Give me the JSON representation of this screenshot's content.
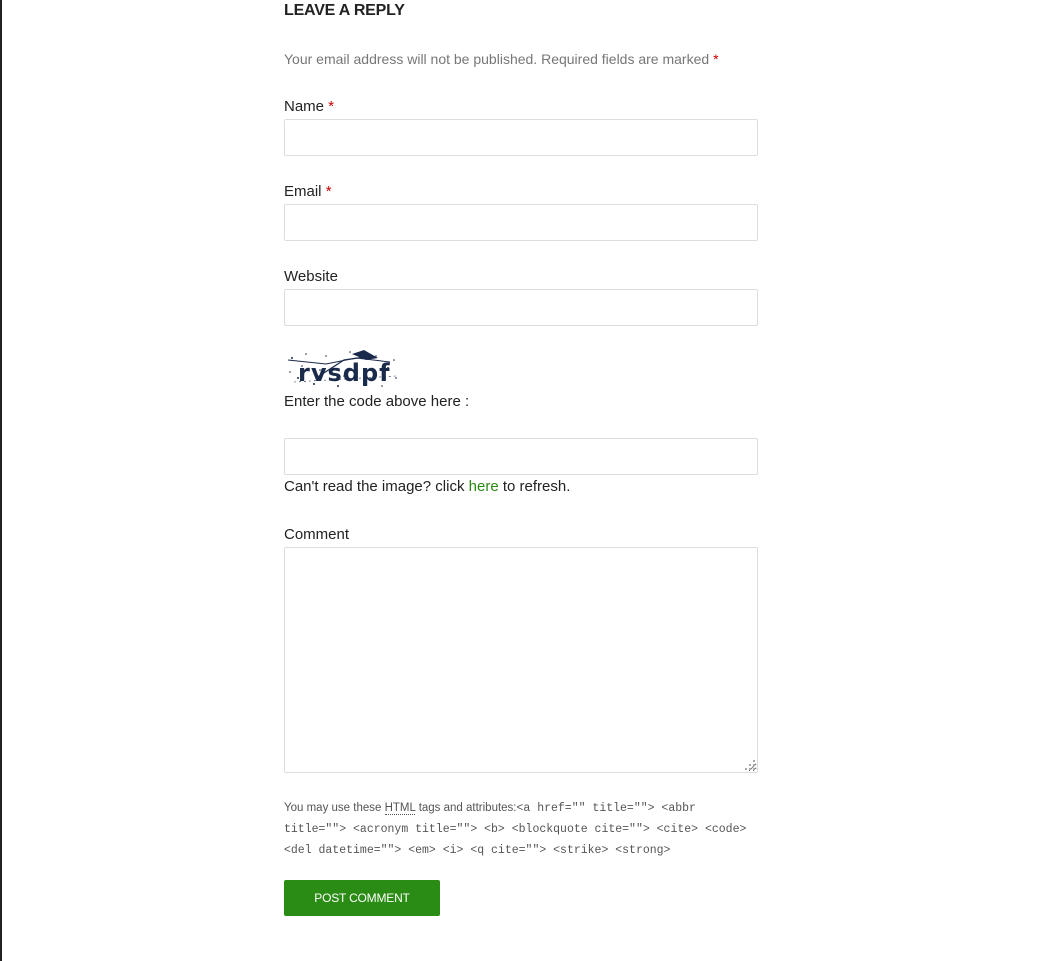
{
  "reply": {
    "title": "LEAVE A REPLY",
    "notes": "Your email address will not be published. Required fields are marked",
    "required_marker": "*"
  },
  "fields": {
    "name": {
      "label": "Name",
      "value": ""
    },
    "email": {
      "label": "Email",
      "value": ""
    },
    "website": {
      "label": "Website",
      "value": ""
    }
  },
  "captcha": {
    "image_text": "rvsdpf",
    "label": "Enter the code above here :",
    "value": "",
    "refresh_prefix": "Can't read the image? click",
    "refresh_link": "here",
    "refresh_suffix": "to refresh."
  },
  "comment": {
    "label": "Comment",
    "value": ""
  },
  "allowed_tags": {
    "prefix": "You may use these",
    "abbr": "HTML",
    "middle": "tags and attributes:",
    "code": "<a href=\"\" title=\"\"> <abbr title=\"\"> <acronym title=\"\"> <b> <blockquote cite=\"\"> <cite> <code> <del datetime=\"\"> <em> <i> <q cite=\"\"> <strike> <strong>"
  },
  "submit": {
    "label": "POST COMMENT"
  },
  "colors": {
    "accent_green": "#2a8c14",
    "link_green": "#2a8a14",
    "required_red": "#cc0000",
    "captcha_ink": "#1a2a4a"
  }
}
